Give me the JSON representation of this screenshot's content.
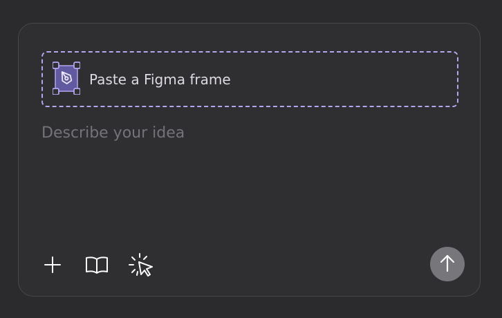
{
  "composer": {
    "figma_dropzone": {
      "label": "Paste a Figma frame",
      "icon": "figma-frame-icon",
      "accent_color": "#b4a6f0"
    },
    "prompt": {
      "placeholder": "Describe your idea",
      "value": ""
    },
    "toolbar": {
      "buttons": [
        {
          "icon": "plus-icon"
        },
        {
          "icon": "book-icon"
        },
        {
          "icon": "cursor-click-icon"
        }
      ],
      "send_icon": "arrow-up-icon"
    }
  },
  "colors": {
    "background": "#2b2a2d",
    "card_background": "#2f2e31",
    "card_border": "#48474b",
    "send_button": "#77767b"
  }
}
